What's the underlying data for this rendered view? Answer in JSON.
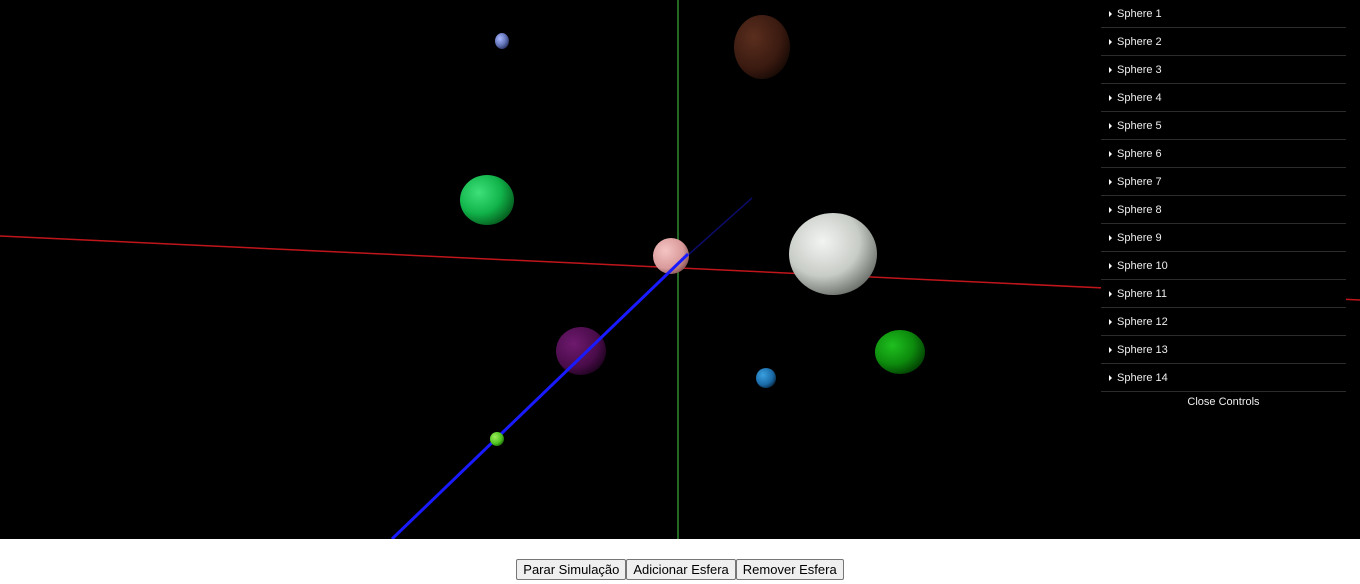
{
  "gui": {
    "folders": [
      "Sphere 1",
      "Sphere 2",
      "Sphere 3",
      "Sphere 4",
      "Sphere 5",
      "Sphere 6",
      "Sphere 7",
      "Sphere 8",
      "Sphere 9",
      "Sphere 10",
      "Sphere 11",
      "Sphere 12",
      "Sphere 13",
      "Sphere 14"
    ],
    "close_label": "Close Controls"
  },
  "buttons": {
    "stop": "Parar Simulação",
    "add": "Adicionar Esfera",
    "remove": "Remover Esfera"
  },
  "colors": {
    "background": "#000000",
    "x_axis": "#c0151b",
    "y_axis": "#2e8b2e",
    "z_axis": "#1a1aff"
  }
}
